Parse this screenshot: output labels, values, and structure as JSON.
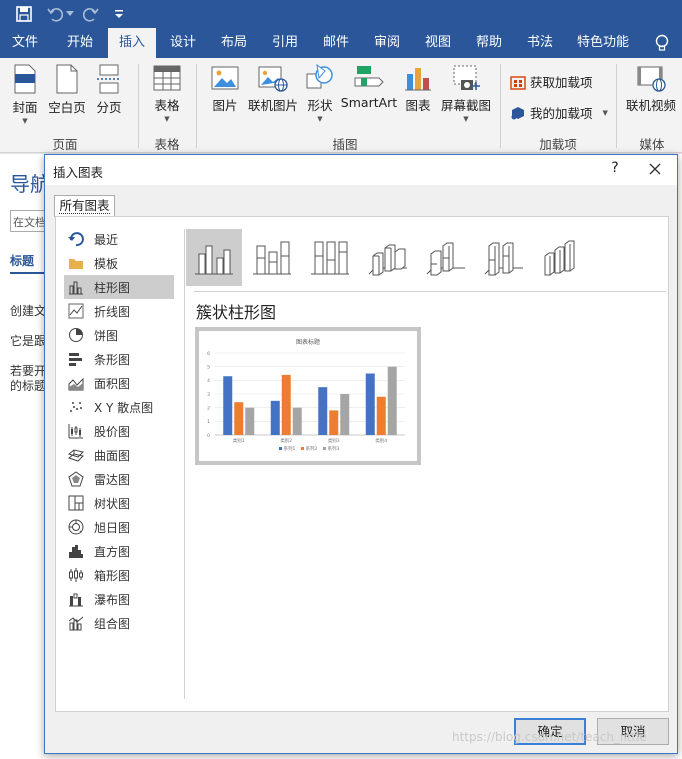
{
  "ribbon_tabs": [
    "文件",
    "开始",
    "插入",
    "设计",
    "布局",
    "引用",
    "邮件",
    "审阅",
    "视图",
    "帮助",
    "书法",
    "特色功能"
  ],
  "ribbon": {
    "cover": "封面",
    "blank_page": "空白页",
    "page_break": "分页",
    "table": "表格",
    "picture": "图片",
    "online_picture": "联机图片",
    "shapes": "形状",
    "smartart": "SmartArt",
    "chart": "图表",
    "screenshot": "屏幕截图",
    "get_addins": "获取加载项",
    "my_addins": "我的加载项",
    "online_video": "联机视频",
    "group_pages": "页面",
    "group_tables": "表格",
    "group_illustrations": "插图",
    "group_addins": "加载项",
    "group_media": "媒体"
  },
  "nav_pane": {
    "title": "导航",
    "search": "在文档",
    "tab": "标题",
    "line1": "创建文",
    "line2": "它是跟",
    "line3": "若要开",
    "line4": "的标题"
  },
  "dialog": {
    "title": "插入图表",
    "help": "?",
    "tab": "所有图表",
    "chart_types": [
      {
        "label": "最近",
        "icon": "recent-icon"
      },
      {
        "label": "模板",
        "icon": "folder-icon"
      },
      {
        "label": "柱形图",
        "icon": "column-chart-icon"
      },
      {
        "label": "折线图",
        "icon": "line-chart-icon"
      },
      {
        "label": "饼图",
        "icon": "pie-chart-icon"
      },
      {
        "label": "条形图",
        "icon": "bar-chart-icon"
      },
      {
        "label": "面积图",
        "icon": "area-chart-icon"
      },
      {
        "label": "X Y 散点图",
        "icon": "scatter-chart-icon"
      },
      {
        "label": "股价图",
        "icon": "stock-chart-icon"
      },
      {
        "label": "曲面图",
        "icon": "surface-chart-icon"
      },
      {
        "label": "雷达图",
        "icon": "radar-chart-icon"
      },
      {
        "label": "树状图",
        "icon": "treemap-chart-icon"
      },
      {
        "label": "旭日图",
        "icon": "sunburst-chart-icon"
      },
      {
        "label": "直方图",
        "icon": "histogram-chart-icon"
      },
      {
        "label": "箱形图",
        "icon": "box-chart-icon"
      },
      {
        "label": "瀑布图",
        "icon": "waterfall-chart-icon"
      },
      {
        "label": "组合图",
        "icon": "combo-chart-icon"
      }
    ],
    "selected_type": "柱形图",
    "subtype_title": "簇状柱形图",
    "ok": "确定",
    "cancel": "取消"
  },
  "colors": {
    "accent": "#2b579a",
    "series1": "#4472c4",
    "series2": "#ed7d31",
    "series3": "#a5a5a5"
  },
  "chart_data": {
    "type": "bar",
    "title": "图表标题",
    "categories": [
      "类别1",
      "类别2",
      "类别3",
      "类别4"
    ],
    "series": [
      {
        "name": "系列1",
        "values": [
          4.3,
          2.5,
          3.5,
          4.5
        ]
      },
      {
        "name": "系列2",
        "values": [
          2.4,
          4.4,
          1.8,
          2.8
        ]
      },
      {
        "name": "系列3",
        "values": [
          2,
          2,
          3,
          5
        ]
      }
    ],
    "ylim": [
      0,
      6
    ],
    "yticks": [
      "0",
      "1",
      "2",
      "3",
      "4",
      "5",
      "6"
    ],
    "grid": true,
    "legend": "bottom"
  },
  "watermark": "https://blog.csdn.net/teach_little"
}
